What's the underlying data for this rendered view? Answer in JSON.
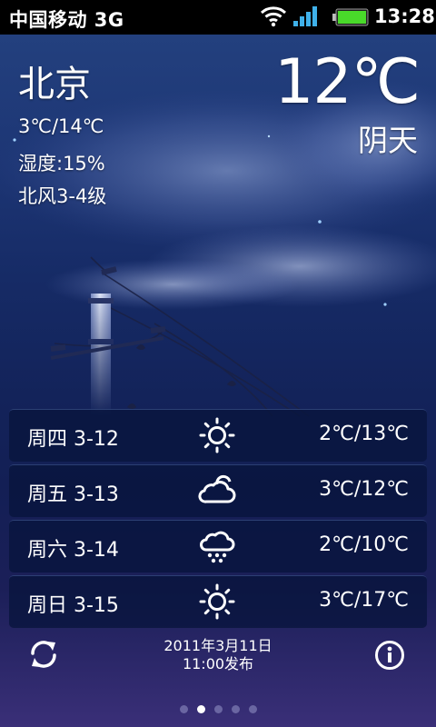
{
  "status_bar": {
    "carrier": "中国移动 3G",
    "time": "13:28"
  },
  "current": {
    "city": "北京",
    "temperature": "12℃",
    "condition": "阴天",
    "temp_range": "3℃/14℃",
    "humidity": "湿度:15%",
    "wind": "北风3-4级"
  },
  "forecast": [
    {
      "day": "周四 3-12",
      "icon": "sun-icon",
      "temp": "2℃/13℃"
    },
    {
      "day": "周五 3-13",
      "icon": "cloud-icon",
      "temp": "3℃/12℃"
    },
    {
      "day": "周六 3-14",
      "icon": "snow-icon",
      "temp": "2℃/10℃"
    },
    {
      "day": "周日 3-15",
      "icon": "sun-icon",
      "temp": "3℃/17℃"
    }
  ],
  "publish": {
    "date": "2011年3月11日",
    "time": "11:00发布"
  },
  "pager": {
    "total": 5,
    "active": 1
  },
  "colors": {
    "sky_top": "#23407e",
    "sky_bottom": "#3a2f78",
    "battery": "#49d92a",
    "signal": "#3fb1ea"
  }
}
